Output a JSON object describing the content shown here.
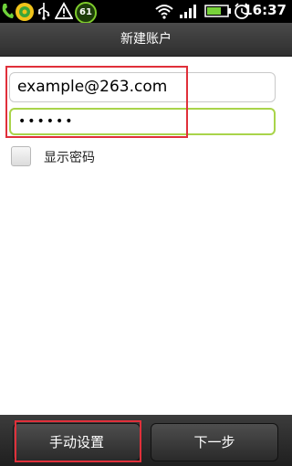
{
  "status_bar": {
    "battery_percent": "61",
    "time": "16:37"
  },
  "header": {
    "title": "新建账户"
  },
  "form": {
    "email_value": "example@263.com",
    "password_masked": "••••••",
    "show_password_label": "显示密码",
    "show_password_checked": false
  },
  "bottom_bar": {
    "manual_setup_label": "手动设置",
    "next_label": "下一步"
  },
  "colors": {
    "status_bar_bg": "#000000",
    "title_bar_bg": "#3a3a3a",
    "focus_border": "#a9d44a",
    "highlight_annotation": "#e0303a"
  },
  "icons": {
    "status_left": [
      "phone-icon",
      "app-icon",
      "usb-icon",
      "warning-icon"
    ],
    "status_right": [
      "wifi-icon",
      "signal-icon",
      "battery-icon",
      "alarm-icon"
    ]
  }
}
